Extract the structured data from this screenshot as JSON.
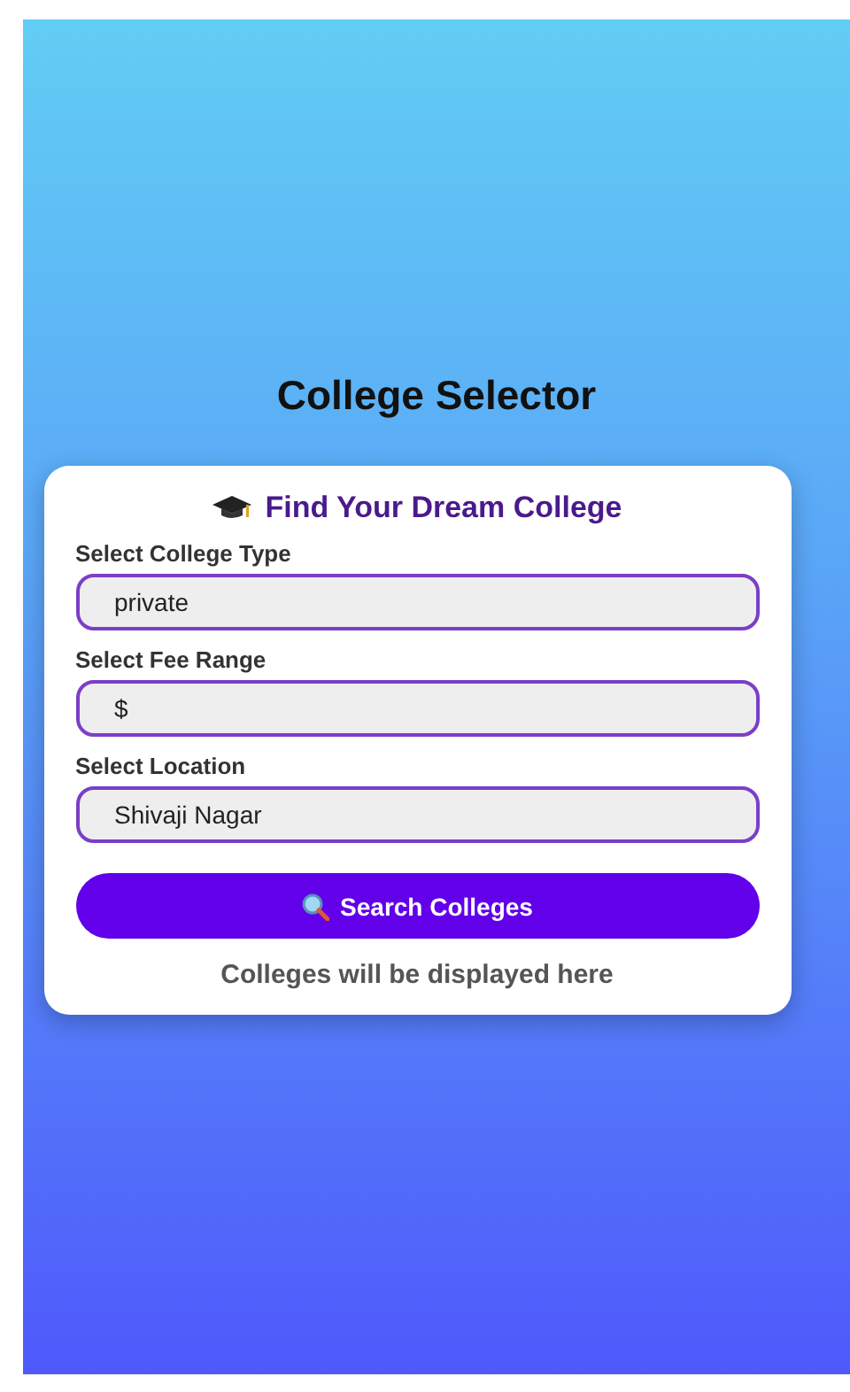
{
  "title": "College Selector",
  "card": {
    "heading": "Find Your Dream College",
    "fields": [
      {
        "label": "Select College Type",
        "value": "private"
      },
      {
        "label": "Select Fee Range",
        "value": "$"
      },
      {
        "label": "Select Location",
        "value": "Shivaji Nagar"
      }
    ],
    "button": "Search Colleges",
    "message": "Colleges will be displayed here"
  }
}
